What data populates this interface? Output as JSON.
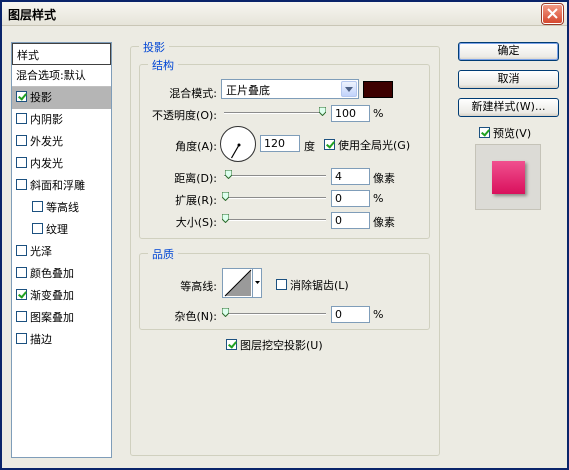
{
  "window": {
    "title": "图层样式"
  },
  "left_list": {
    "header": "样式",
    "blend_options": "混合选项:默认",
    "items": [
      {
        "label": "投影",
        "checked": true,
        "selected": true,
        "indent": false
      },
      {
        "label": "内阴影",
        "checked": false,
        "selected": false,
        "indent": false
      },
      {
        "label": "外发光",
        "checked": false,
        "selected": false,
        "indent": false
      },
      {
        "label": "内发光",
        "checked": false,
        "selected": false,
        "indent": false
      },
      {
        "label": "斜面和浮雕",
        "checked": false,
        "selected": false,
        "indent": false
      },
      {
        "label": "等高线",
        "checked": false,
        "selected": false,
        "indent": true
      },
      {
        "label": "纹理",
        "checked": false,
        "selected": false,
        "indent": true
      },
      {
        "label": "光泽",
        "checked": false,
        "selected": false,
        "indent": false
      },
      {
        "label": "颜色叠加",
        "checked": false,
        "selected": false,
        "indent": false
      },
      {
        "label": "渐变叠加",
        "checked": true,
        "selected": false,
        "indent": false
      },
      {
        "label": "图案叠加",
        "checked": false,
        "selected": false,
        "indent": false
      },
      {
        "label": "描边",
        "checked": false,
        "selected": false,
        "indent": false
      }
    ]
  },
  "drop_shadow": {
    "title": "投影",
    "structure": {
      "title": "结构",
      "blend_mode_label": "混合模式:",
      "blend_mode_value": "正片叠底",
      "shadow_color": "#3d0000",
      "opacity_label": "不透明度(O):",
      "opacity_value": "100",
      "opacity_unit": "%",
      "opacity_fraction": 1.0,
      "angle_label": "角度(A):",
      "angle_value": "120",
      "angle_unit": "度",
      "global_light_label": "使用全局光(G)",
      "global_light_checked": true,
      "distance_label": "距离(D):",
      "distance_value": "4",
      "distance_unit": "像素",
      "spread_label": "扩展(R):",
      "spread_value": "0",
      "spread_unit": "%",
      "size_label": "大小(S):",
      "size_value": "0",
      "size_unit": "像素"
    },
    "quality": {
      "title": "品质",
      "contour_label": "等高线:",
      "antialias_label": "消除锯齿(L)",
      "antialias_checked": false,
      "noise_label": "杂色(N):",
      "noise_value": "0",
      "noise_unit": "%"
    },
    "knockout_label": "图层挖空投影(U)",
    "knockout_checked": true
  },
  "buttons": {
    "ok": "确定",
    "cancel": "取消",
    "new_style": "新建样式(W)...",
    "preview_label": "预览(V)",
    "preview_checked": true
  },
  "colors": {
    "accent_blue": "#0046d5",
    "preview_swatch": "#e0206a"
  }
}
